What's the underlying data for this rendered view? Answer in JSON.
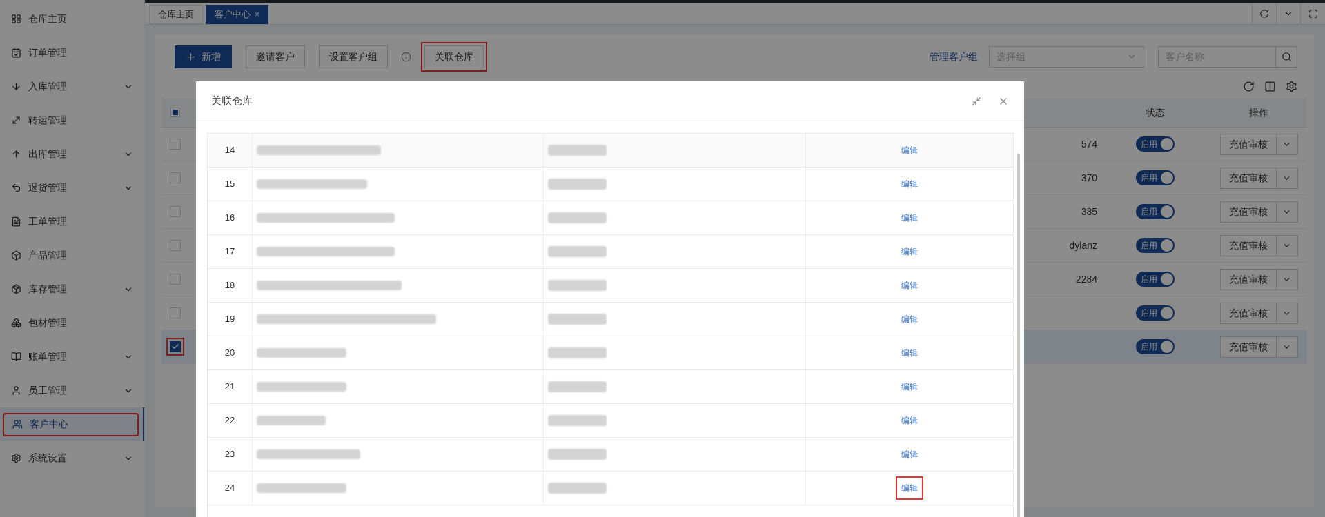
{
  "sidebar": {
    "items": [
      {
        "label": "仓库主页",
        "expandable": false,
        "selected": false,
        "highlighted": false
      },
      {
        "label": "订单管理",
        "expandable": false,
        "selected": false,
        "highlighted": false
      },
      {
        "label": "入库管理",
        "expandable": true,
        "selected": false,
        "highlighted": false
      },
      {
        "label": "转运管理",
        "expandable": false,
        "selected": false,
        "highlighted": false
      },
      {
        "label": "出库管理",
        "expandable": true,
        "selected": false,
        "highlighted": false
      },
      {
        "label": "退货管理",
        "expandable": true,
        "selected": false,
        "highlighted": false
      },
      {
        "label": "工单管理",
        "expandable": false,
        "selected": false,
        "highlighted": false
      },
      {
        "label": "产品管理",
        "expandable": false,
        "selected": false,
        "highlighted": false
      },
      {
        "label": "库存管理",
        "expandable": true,
        "selected": false,
        "highlighted": false
      },
      {
        "label": "包材管理",
        "expandable": false,
        "selected": false,
        "highlighted": false
      },
      {
        "label": "账单管理",
        "expandable": true,
        "selected": false,
        "highlighted": false
      },
      {
        "label": "员工管理",
        "expandable": true,
        "selected": false,
        "highlighted": false
      },
      {
        "label": "客户中心",
        "expandable": false,
        "selected": true,
        "highlighted": true
      },
      {
        "label": "系统设置",
        "expandable": true,
        "selected": false,
        "highlighted": false
      }
    ]
  },
  "tabs": [
    {
      "label": "仓库主页",
      "selected": false
    },
    {
      "label": "客户中心",
      "selected": true,
      "close": "×"
    }
  ],
  "toolbar": {
    "buttons": [
      {
        "kind": "primary",
        "label": "新增",
        "highlighted": false
      },
      {
        "kind": "default",
        "label": "邀请客户",
        "highlighted": false
      },
      {
        "kind": "default",
        "label": "设置客户组",
        "highlighted": false
      },
      {
        "kind": "info"
      },
      {
        "kind": "default",
        "label": "关联仓库",
        "highlighted": true
      }
    ],
    "group_link": "管理客户组",
    "group_select": {
      "placeholder": "选择组"
    },
    "search": {
      "placeholder": "客户名称"
    }
  },
  "table": {
    "header_checkbox": {
      "indeterminate": true
    },
    "columns": [
      "状态",
      "操作"
    ],
    "rows": [
      {
        "checked": false,
        "value": "574",
        "status": "启用",
        "on": true,
        "action": "充值审核",
        "selected": false,
        "highlighted": false
      },
      {
        "checked": false,
        "value": "370",
        "status": "启用",
        "on": true,
        "action": "充值审核",
        "selected": false,
        "highlighted": false
      },
      {
        "checked": false,
        "value": "385",
        "status": "启用",
        "on": true,
        "action": "充值审核",
        "selected": false,
        "highlighted": false
      },
      {
        "checked": false,
        "value": "dylanz",
        "status": "启用",
        "on": true,
        "action": "充值审核",
        "selected": false,
        "highlighted": false
      },
      {
        "checked": false,
        "value": "2284",
        "status": "启用",
        "on": true,
        "action": "充值审核",
        "selected": false,
        "highlighted": false
      },
      {
        "checked": false,
        "status": "启用",
        "on": true,
        "action": "充值审核",
        "selected": false,
        "highlighted": false
      },
      {
        "checked": true,
        "status": "启用",
        "on": true,
        "action": "充值审核",
        "selected": true,
        "highlighted": true
      }
    ]
  },
  "modal": {
    "title": "关联仓库",
    "rows": [
      {
        "index": "14",
        "action": "编辑",
        "highlighted": false
      },
      {
        "index": "15",
        "action": "编辑",
        "highlighted": false
      },
      {
        "index": "16",
        "action": "编辑",
        "highlighted": false
      },
      {
        "index": "17",
        "action": "编辑",
        "highlighted": false
      },
      {
        "index": "18",
        "action": "编辑",
        "highlighted": false
      },
      {
        "index": "19",
        "action": "编辑",
        "highlighted": false
      },
      {
        "index": "20",
        "action": "编辑",
        "highlighted": false
      },
      {
        "index": "21",
        "action": "编辑",
        "highlighted": false
      },
      {
        "index": "22",
        "action": "编辑",
        "highlighted": false
      },
      {
        "index": "23",
        "action": "编辑",
        "highlighted": false
      },
      {
        "index": "24",
        "action": "编辑",
        "highlighted": true
      }
    ]
  }
}
